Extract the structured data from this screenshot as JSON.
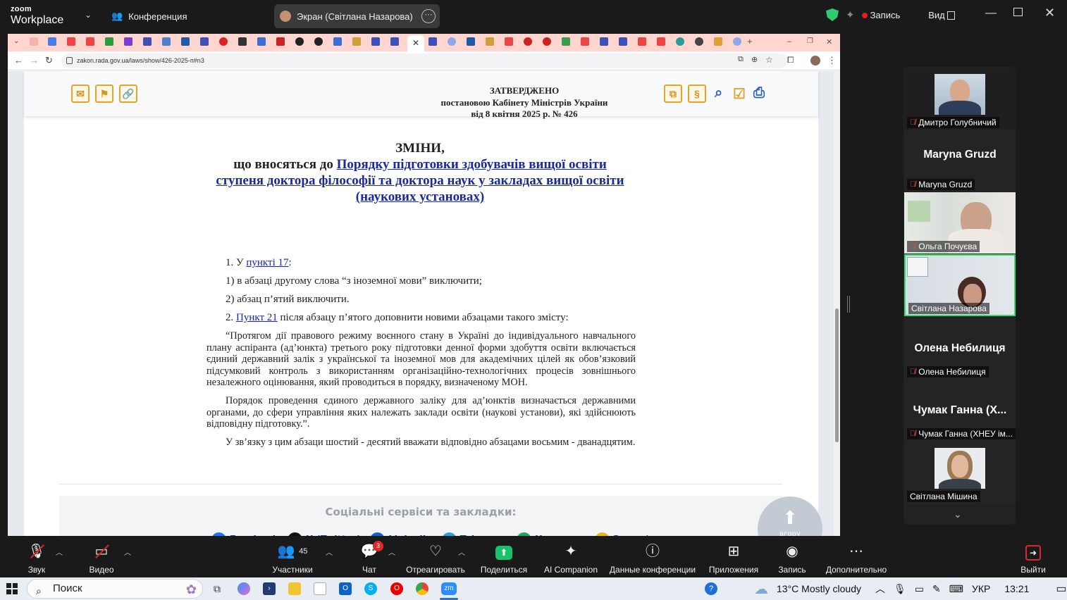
{
  "zoom": {
    "app_small": "zoom",
    "app_big": "Workplace",
    "conference_label": "Конференция",
    "screen_share_label": "Экран (Світлана Назарова)",
    "recording_label": "Запись",
    "view_label": "Вид"
  },
  "browser": {
    "url": "zakon.rada.gov.ua/laws/show/426-2025-п#n3"
  },
  "page": {
    "approved_lines": [
      "ЗАТВЕРДЖЕНО",
      "постановою Кабінету Міністрів України",
      "від 8 квітня 2025 р. № 426"
    ],
    "title_main": "ЗМІНИ,",
    "title_prefix": "що вносяться до ",
    "title_link": "Порядку підготовки здобувачів вищої освіти ступеня доктора філософії та доктора наук у закладах вищої освіти (наукових установах)",
    "p1_prefix": "1. У ",
    "p1_link": "пункті 17",
    "p1_suffix": ":",
    "p1_1": "1) в абзаці другому слова “з іноземної мови” виключити;",
    "p1_2": "2) абзац п’ятий виключити.",
    "p2_prefix": "2. ",
    "p2_link": "Пункт 21",
    "p2_suffix": " після абзацу п’ятого доповнити новими абзацами такого змісту:",
    "quote_1": "“Протягом дії правового режиму воєнного стану в Україні до індивідуального навчального плану аспіранта (ад’юнкта) третього року підготовки денної форми здобуття освіти включається єдиний державний залік з української та іноземної мов для академічних цілей як обов’язковий підсумковий контроль з використанням організаційно-технологічних процесів зовнішнього незалежного оцінювання, який проводиться в порядку, визначеному МОН.",
    "quote_2": "Порядок проведення єдиного державного заліку для ад’юнктів визначається державними органами, до сфери управління яких належать заклади освіти (наукові установи), які здійснюють відповідну підготовку.”.",
    "closing": "У зв’язку з цим абзаци шостий - десятий вважати відповідно абзацами восьмим - дванадцятим.",
    "social_title": "Соціальні сервіси та закладки:",
    "social": [
      {
        "label": "Facebook",
        "icon": "f",
        "color": "#1877f2"
      },
      {
        "label": "X (Twitter)",
        "icon": "X",
        "color": "#111111"
      },
      {
        "label": "LinkedIn",
        "icon": "in",
        "color": "#0a66c2"
      },
      {
        "label": "Telegram",
        "icon": "➤",
        "color": "#2aa3df"
      },
      {
        "label": "На пошту",
        "icon": "✉",
        "color": "#1fa855"
      },
      {
        "label": "Запам'ятати",
        "icon": "★",
        "color": "#f2b705"
      }
    ],
    "social_text_color": "#1a3fa0",
    "to_top_label": "вгору"
  },
  "participants": [
    {
      "name": "Дмитро Голубничий",
      "type": "photo",
      "muted": true
    },
    {
      "name": "Maryna Gruzd",
      "type": "name",
      "display": "Maryna Gruzd",
      "muted": true
    },
    {
      "name": "Ольга Почуєва",
      "type": "video",
      "muted": true
    },
    {
      "name": "Світлана Назарова",
      "type": "video-active",
      "muted": false
    },
    {
      "name": "Олена Небилиця",
      "type": "name",
      "display": "Олена Небилиця",
      "muted": true
    },
    {
      "name": "Чумак Ганна (ХНЕУ ім...",
      "type": "name",
      "display": "Чумак Ганна (Х...",
      "muted": true
    },
    {
      "name": "Світлана Мішина",
      "type": "photo",
      "muted": false
    }
  ],
  "toolbar": {
    "audio": "Звук",
    "video": "Видео",
    "participants": "Участники",
    "participants_count": "45",
    "chat": "Чат",
    "chat_badge": "3",
    "react": "Отреагировать",
    "share": "Поделиться",
    "ai": "AI Companion",
    "info": "Данные конференции",
    "apps": "Приложения",
    "record": "Запись",
    "more": "Дополнительно",
    "leave": "Выйти"
  },
  "taskbar": {
    "search": "Поиск",
    "weather": "13°C  Mostly cloudy",
    "lang": "УКР",
    "time": "13:21"
  }
}
